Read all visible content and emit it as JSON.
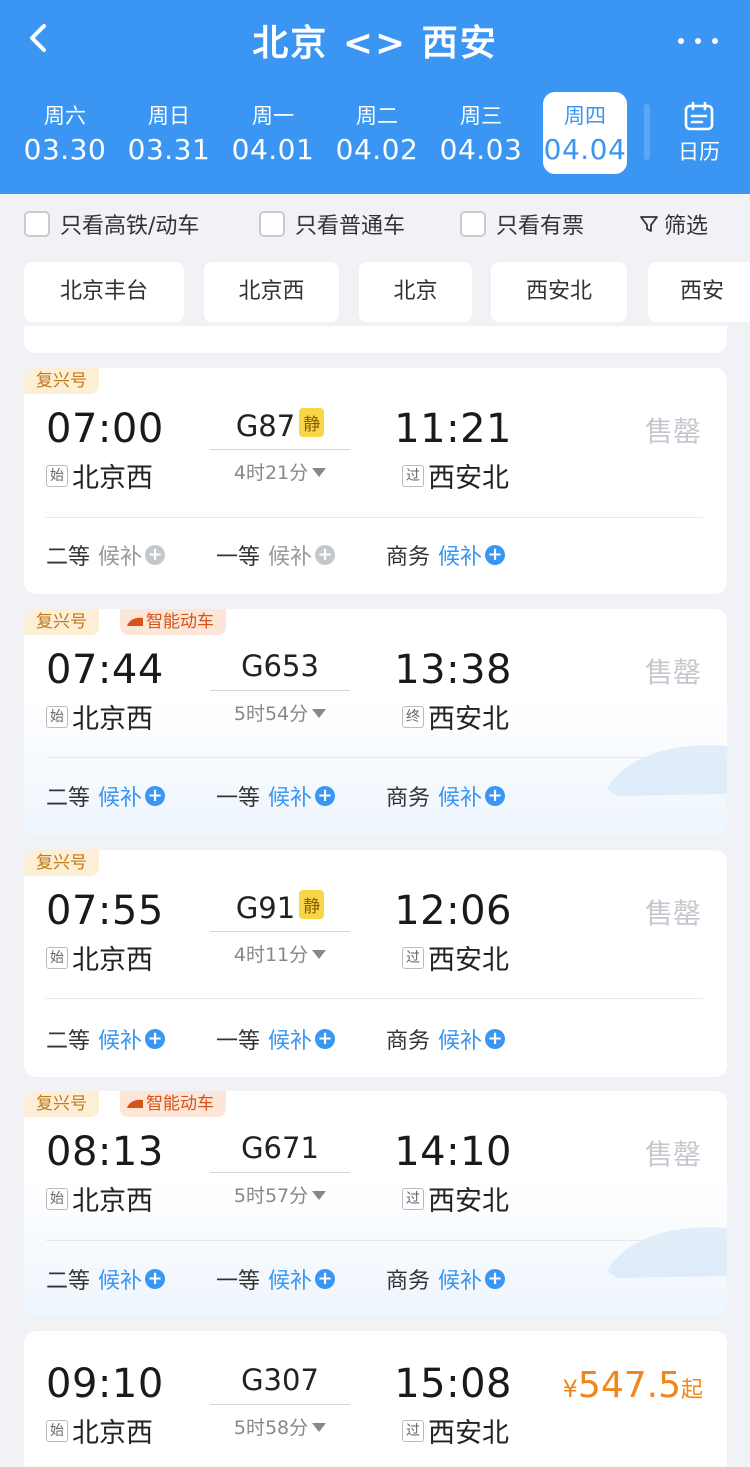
{
  "header": {
    "title": "北京 <> 西安",
    "back_icon": "chevron-left-icon",
    "more_icon": "more-dots-icon",
    "calendar_label": "日历"
  },
  "dates": [
    {
      "weekday": "周六",
      "date": "03.30"
    },
    {
      "weekday": "周日",
      "date": "03.31"
    },
    {
      "weekday": "周一",
      "date": "04.01"
    },
    {
      "weekday": "周二",
      "date": "04.02"
    },
    {
      "weekday": "周三",
      "date": "04.03"
    },
    {
      "weekday": "周四",
      "date": "04.04",
      "selected": true
    }
  ],
  "filters": {
    "only_high_speed": "只看高铁/动车",
    "only_normal": "只看普通车",
    "only_available": "只看有票",
    "filter_label": "筛选"
  },
  "stations": [
    "北京丰台",
    "北京西",
    "北京",
    "西安北",
    "西安"
  ],
  "trains": [
    {
      "tags": [
        "复兴号"
      ],
      "dep_time": "07:00",
      "train_no": "G87",
      "quiet": "静",
      "arr_time": "11:21",
      "duration": "4时21分",
      "dep_mark": "始",
      "dep_station": "北京西",
      "arr_mark": "过",
      "arr_station": "西安北",
      "status": "售罄",
      "seats": [
        {
          "class": "二等",
          "state": "候补",
          "available": false
        },
        {
          "class": "一等",
          "state": "候补",
          "available": false
        },
        {
          "class": "商务",
          "state": "候补",
          "available": true
        }
      ]
    },
    {
      "tags": [
        "复兴号",
        "智能动车"
      ],
      "dep_time": "07:44",
      "train_no": "G653",
      "arr_time": "13:38",
      "duration": "5时54分",
      "dep_mark": "始",
      "dep_station": "北京西",
      "arr_mark": "终",
      "arr_station": "西安北",
      "status": "售罄",
      "seats": [
        {
          "class": "二等",
          "state": "候补",
          "available": true
        },
        {
          "class": "一等",
          "state": "候补",
          "available": true
        },
        {
          "class": "商务",
          "state": "候补",
          "available": true
        }
      ]
    },
    {
      "tags": [
        "复兴号"
      ],
      "dep_time": "07:55",
      "train_no": "G91",
      "quiet": "静",
      "arr_time": "12:06",
      "duration": "4时11分",
      "dep_mark": "始",
      "dep_station": "北京西",
      "arr_mark": "过",
      "arr_station": "西安北",
      "status": "售罄",
      "seats": [
        {
          "class": "二等",
          "state": "候补",
          "available": true
        },
        {
          "class": "一等",
          "state": "候补",
          "available": true
        },
        {
          "class": "商务",
          "state": "候补",
          "available": true
        }
      ]
    },
    {
      "tags": [
        "复兴号",
        "智能动车"
      ],
      "dep_time": "08:13",
      "train_no": "G671",
      "arr_time": "14:10",
      "duration": "5时57分",
      "dep_mark": "始",
      "dep_station": "北京西",
      "arr_mark": "过",
      "arr_station": "西安北",
      "status": "售罄",
      "seats": [
        {
          "class": "二等",
          "state": "候补",
          "available": true
        },
        {
          "class": "一等",
          "state": "候补",
          "available": true
        },
        {
          "class": "商务",
          "state": "候补",
          "available": true
        }
      ]
    },
    {
      "tags": [],
      "dep_time": "09:10",
      "train_no": "G307",
      "arr_time": "15:08",
      "duration": "5时58分",
      "dep_mark": "始",
      "dep_station": "北京西",
      "arr_mark": "过",
      "arr_station": "西安北",
      "price_symbol": "¥",
      "price": "547.5",
      "price_suffix": "起"
    }
  ],
  "colors": {
    "primary": "#3a96f2",
    "sold_out": "#c4c8ce",
    "price": "#f0861c",
    "tag_fuxing": "#fdeed6",
    "tag_smart": "#fde6d8"
  }
}
